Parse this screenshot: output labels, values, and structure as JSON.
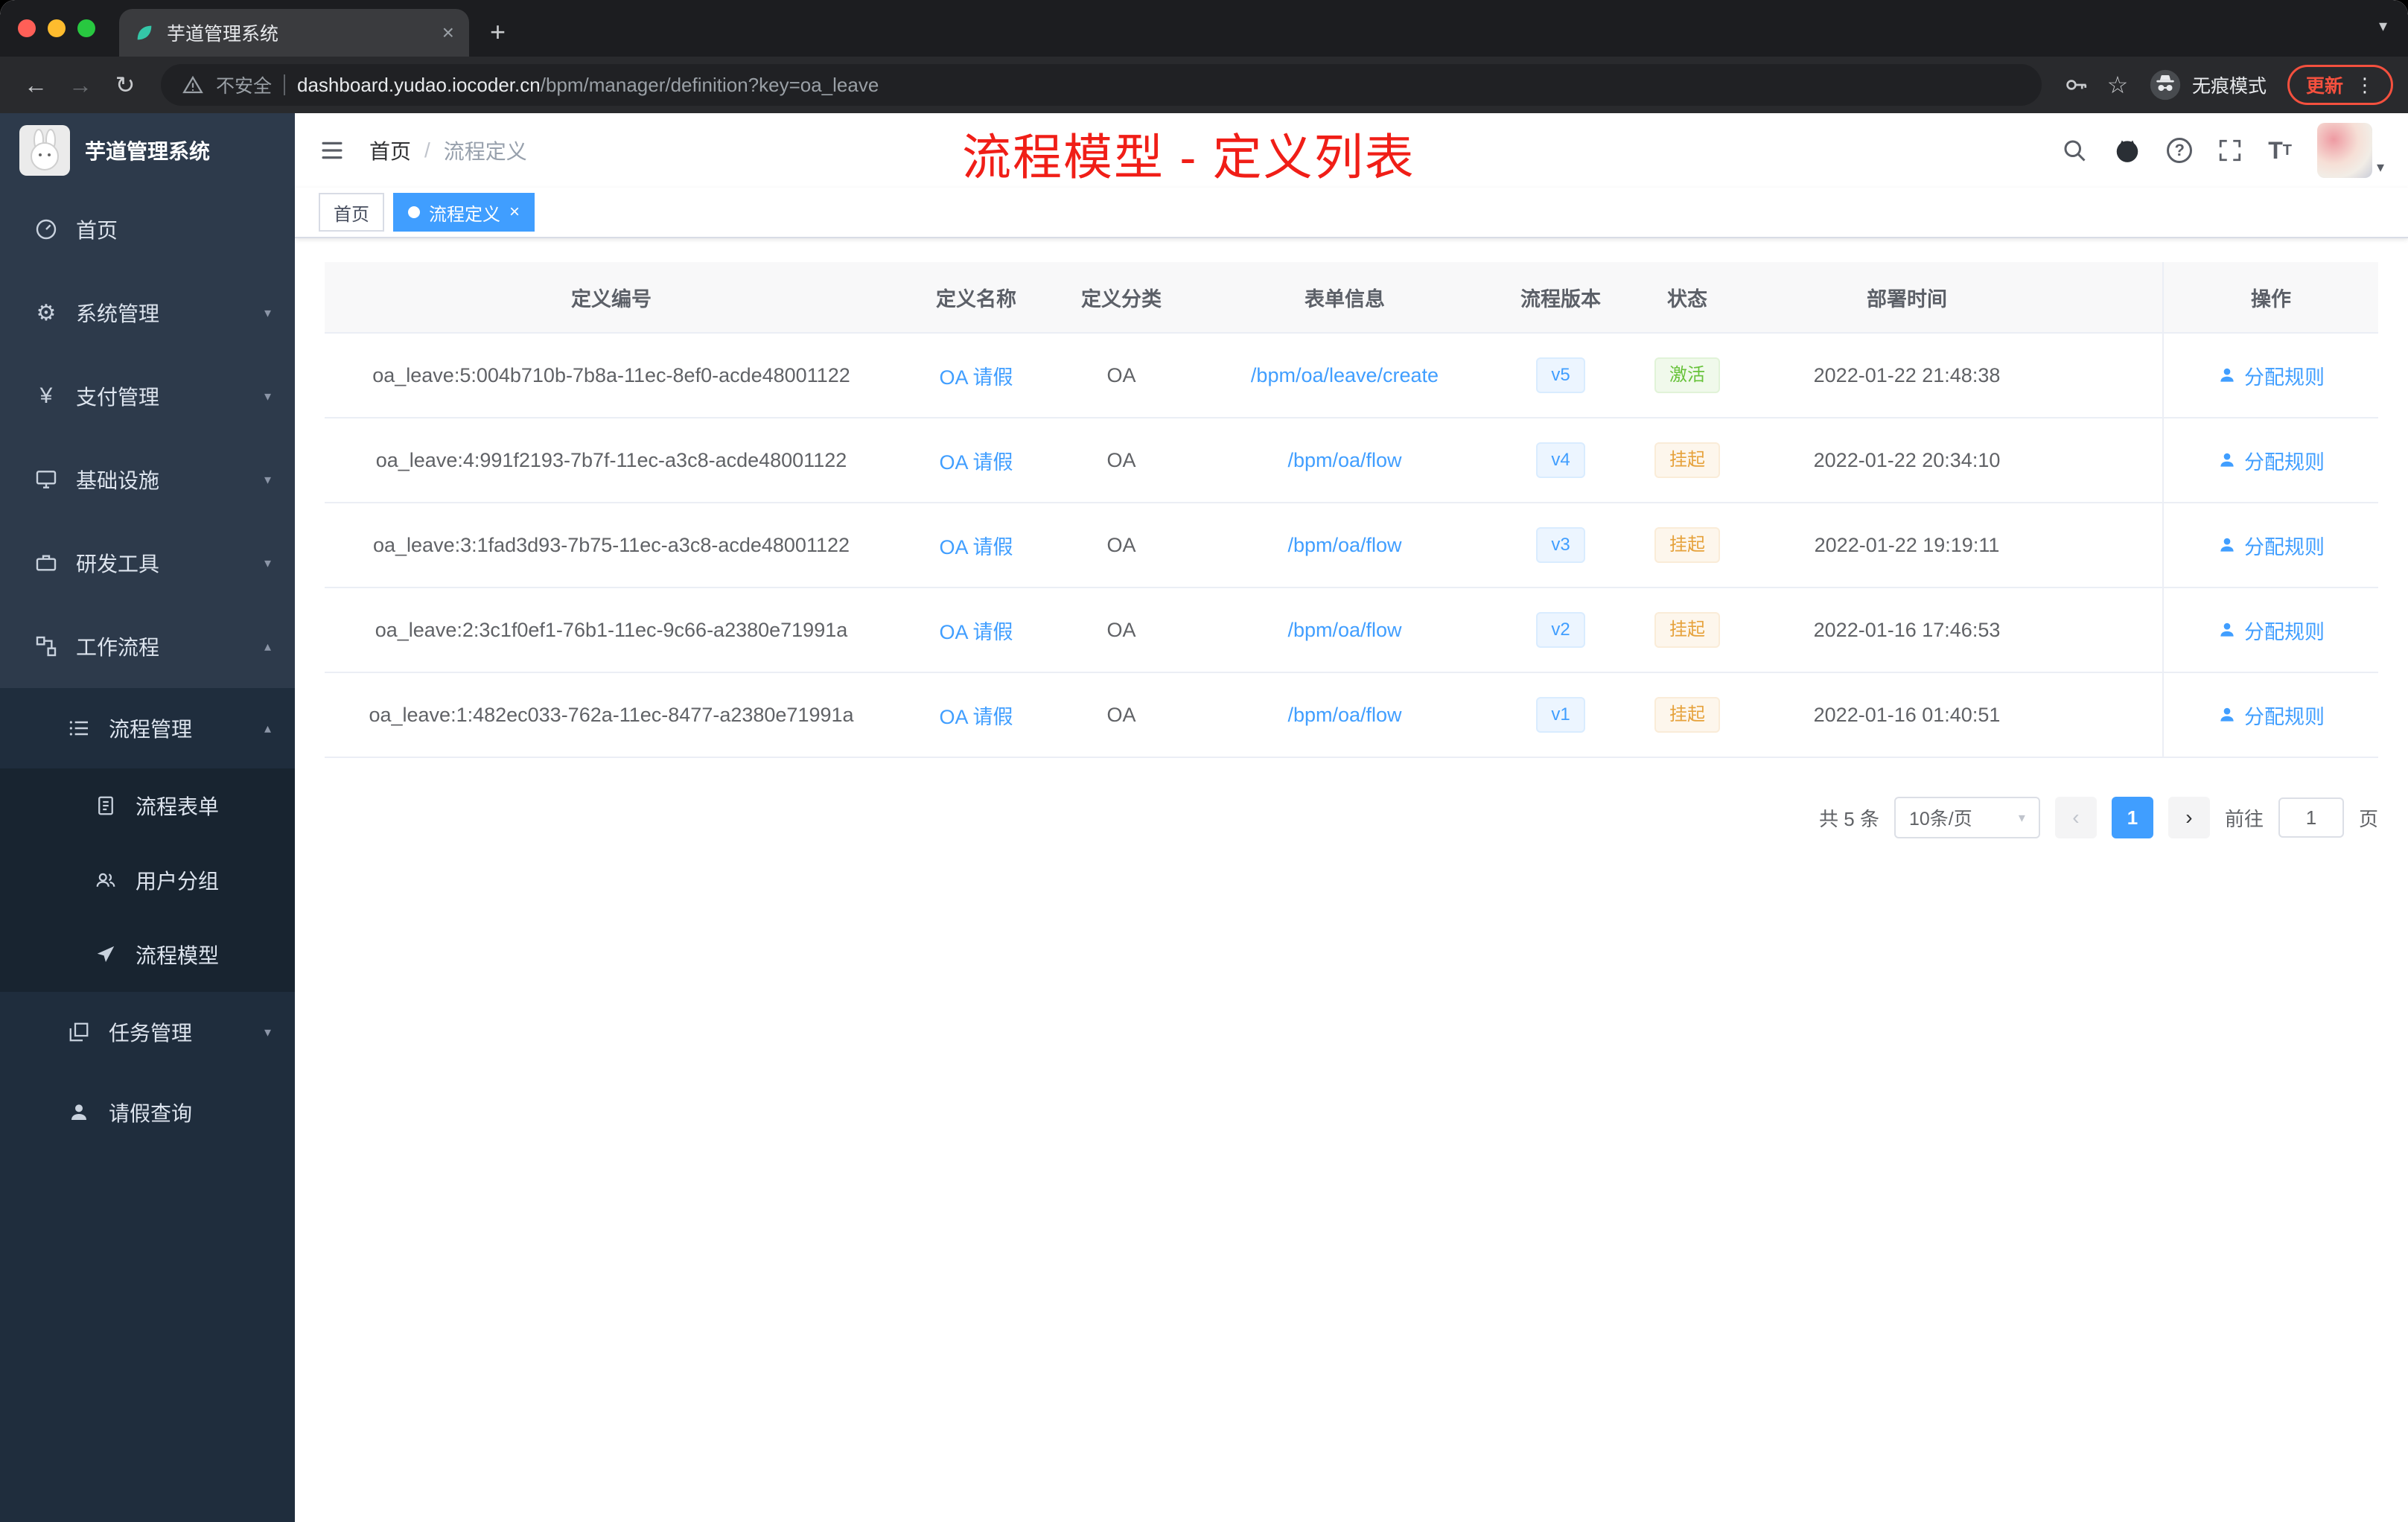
{
  "colors": {
    "primary": "#409eff",
    "annotation_red": "#f01e17",
    "success_green": "#67c23a",
    "warning_orange": "#e6a23c",
    "sidebar_bg": "#2d3a4b",
    "sidebar_submenu_bg": "#1f2d3d"
  },
  "icons": {
    "close": "×",
    "new_tab": "+",
    "tab_search": "▾",
    "back": "←",
    "forward": "→",
    "reload": "↻",
    "menu_dots": "⋮",
    "star": "☆",
    "question": "?",
    "text_size": "T",
    "gear": "⚙",
    "yen": "¥",
    "caret_down": "▾",
    "caret_up": "▴",
    "prev": "‹",
    "next": "›"
  },
  "browser": {
    "tab_title": "芋道管理系统",
    "security_label": "不安全",
    "url_host": "dashboard.yudao.iocoder.cn",
    "url_path": "/bpm/manager/definition?key=oa_leave",
    "incognito_label": "无痕模式",
    "update_label": "更新"
  },
  "sidebar": {
    "brand": "芋道管理系统",
    "items": [
      "首页",
      "系统管理",
      "支付管理",
      "基础设施",
      "研发工具",
      "工作流程"
    ],
    "submenu": {
      "process_management": "流程管理",
      "children": [
        "流程表单",
        "用户分组",
        "流程模型"
      ],
      "task_management": "任务管理",
      "leave_query": "请假查询"
    }
  },
  "header": {
    "breadcrumb_root": "首页",
    "breadcrumb_sep": "/",
    "breadcrumb_current": "流程定义",
    "annotation": "流程模型 - 定义列表"
  },
  "tags": {
    "home": "首页",
    "active": "流程定义"
  },
  "table": {
    "columns": [
      "定义编号",
      "定义名称",
      "定义分类",
      "表单信息",
      "流程版本",
      "状态",
      "部署时间",
      "操作"
    ],
    "rows": [
      {
        "id": "oa_leave:5:004b710b-7b8a-11ec-8ef0-acde48001122",
        "name": "OA 请假",
        "category": "OA",
        "form": "/bpm/oa/leave/create",
        "version": "v5",
        "status": "激活",
        "deployed": "2022-01-22 21:48:38",
        "action": "分配规则"
      },
      {
        "id": "oa_leave:4:991f2193-7b7f-11ec-a3c8-acde48001122",
        "name": "OA 请假",
        "category": "OA",
        "form": "/bpm/oa/flow",
        "version": "v4",
        "status": "挂起",
        "deployed": "2022-01-22 20:34:10",
        "action": "分配规则"
      },
      {
        "id": "oa_leave:3:1fad3d93-7b75-11ec-a3c8-acde48001122",
        "name": "OA 请假",
        "category": "OA",
        "form": "/bpm/oa/flow",
        "version": "v3",
        "status": "挂起",
        "deployed": "2022-01-22 19:19:11",
        "action": "分配规则"
      },
      {
        "id": "oa_leave:2:3c1f0ef1-76b1-11ec-9c66-a2380e71991a",
        "name": "OA 请假",
        "category": "OA",
        "form": "/bpm/oa/flow",
        "version": "v2",
        "status": "挂起",
        "deployed": "2022-01-16 17:46:53",
        "action": "分配规则"
      },
      {
        "id": "oa_leave:1:482ec033-762a-11ec-8477-a2380e71991a",
        "name": "OA 请假",
        "category": "OA",
        "form": "/bpm/oa/flow",
        "version": "v1",
        "status": "挂起",
        "deployed": "2022-01-16 01:40:51",
        "action": "分配规则"
      }
    ]
  },
  "pagination": {
    "total": "共 5 条",
    "page_size": "10条/页",
    "current_page": "1",
    "goto_label": "前往",
    "goto_value": "1",
    "goto_unit": "页"
  }
}
